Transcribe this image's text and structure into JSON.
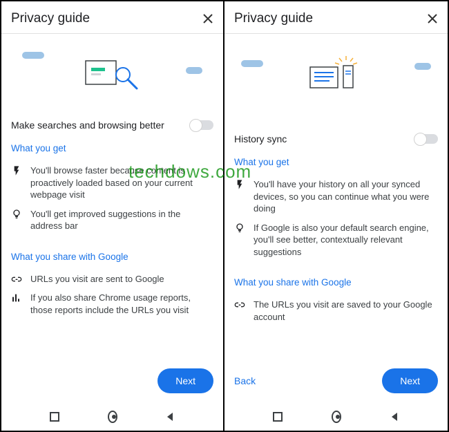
{
  "watermark": "techdows.com",
  "leftPane": {
    "title": "Privacy guide",
    "setting": "Make searches and browsing better",
    "sectionGet": "What you get",
    "get": [
      {
        "icon": "bolt-icon",
        "text": "You'll browse faster because content is proactively loaded based on your current webpage visit"
      },
      {
        "icon": "bulb-icon",
        "text": "You'll get improved suggestions in the address bar"
      }
    ],
    "sectionShare": "What you share with Google",
    "share": [
      {
        "icon": "link-icon",
        "text": "URLs you visit are sent to Google"
      },
      {
        "icon": "bars-icon",
        "text": "If you also share Chrome usage reports, those reports include the URLs you visit"
      }
    ],
    "next": "Next"
  },
  "rightPane": {
    "title": "Privacy guide",
    "setting": "History sync",
    "sectionGet": "What you get",
    "get": [
      {
        "icon": "bolt-icon",
        "text": "You'll have your history on all your synced devices, so you can continue what you were doing"
      },
      {
        "icon": "bulb-icon",
        "text": "If Google is also your default search engine, you'll see better, contextually relevant suggestions"
      }
    ],
    "sectionShare": "What you share with Google",
    "share": [
      {
        "icon": "link-icon",
        "text": "The URLs you visit are saved to your Google account"
      }
    ],
    "back": "Back",
    "next": "Next"
  }
}
